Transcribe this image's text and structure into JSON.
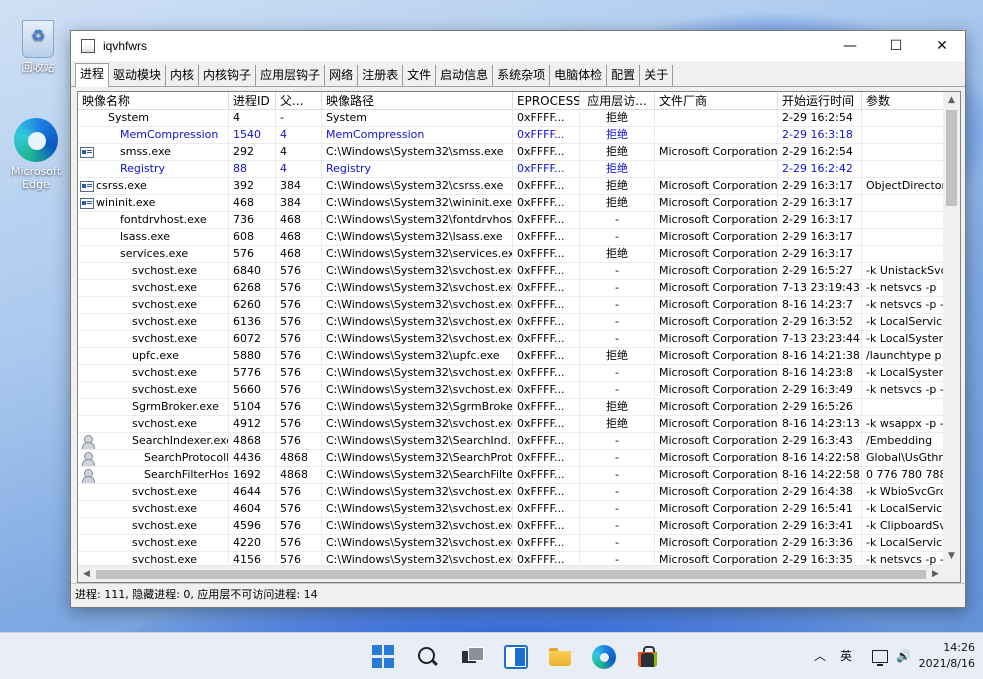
{
  "desktop": {
    "icons": [
      {
        "label": "回收站",
        "icon": "recycle-bin-icon"
      },
      {
        "label": "Microsoft Edge",
        "icon": "edge-icon"
      }
    ]
  },
  "window": {
    "title": "iqvhfwrs",
    "controls": {
      "minimize": "—",
      "maximize": "☐",
      "close": "✕"
    },
    "tabs": [
      "进程",
      "驱动模块",
      "内核",
      "内核钩子",
      "应用层钩子",
      "网络",
      "注册表",
      "文件",
      "启动信息",
      "系统杂项",
      "电脑体检",
      "配置",
      "关于"
    ],
    "active_tab": 0,
    "columns": [
      "映像名称",
      "进程ID",
      "父...",
      "映像路径",
      "EPROCESS",
      "应用层访...",
      "文件厂商",
      "开始运行时间",
      "参数"
    ],
    "rows": [
      {
        "name": "System",
        "indent": 1,
        "icon": "",
        "pid": "4",
        "ppid": "-",
        "path": "System",
        "eproc": "0xFFFF...",
        "access": "拒绝",
        "vendor": "",
        "start": "2-29 16:2:54",
        "args": "",
        "blue": false
      },
      {
        "name": "MemCompression",
        "indent": 2,
        "icon": "",
        "pid": "1540",
        "ppid": "4",
        "path": "MemCompression",
        "eproc": "0xFFFF...",
        "access": "拒绝",
        "vendor": "",
        "start": "2-29 16:3:18",
        "args": "",
        "blue": true
      },
      {
        "name": "smss.exe",
        "indent": 2,
        "icon": "app",
        "pid": "292",
        "ppid": "4",
        "path": "C:\\Windows\\System32\\smss.exe",
        "eproc": "0xFFFF...",
        "access": "拒绝",
        "vendor": "Microsoft Corporation",
        "start": "2-29 16:2:54",
        "args": "",
        "blue": false
      },
      {
        "name": "Registry",
        "indent": 2,
        "icon": "",
        "pid": "88",
        "ppid": "4",
        "path": "Registry",
        "eproc": "0xFFFF...",
        "access": "拒绝",
        "vendor": "",
        "start": "2-29 16:2:42",
        "args": "",
        "blue": true
      },
      {
        "name": "csrss.exe",
        "indent": 0,
        "icon": "app",
        "pid": "392",
        "ppid": "384",
        "path": "C:\\Windows\\System32\\csrss.exe",
        "eproc": "0xFFFF...",
        "access": "拒绝",
        "vendor": "Microsoft Corporation",
        "start": "2-29 16:3:17",
        "args": "ObjectDirector...",
        "blue": false
      },
      {
        "name": "wininit.exe",
        "indent": 0,
        "icon": "app",
        "pid": "468",
        "ppid": "384",
        "path": "C:\\Windows\\System32\\wininit.exe",
        "eproc": "0xFFFF...",
        "access": "拒绝",
        "vendor": "Microsoft Corporation",
        "start": "2-29 16:3:17",
        "args": "",
        "blue": false
      },
      {
        "name": "fontdrvhost.exe",
        "indent": 2,
        "icon": "",
        "pid": "736",
        "ppid": "468",
        "path": "C:\\Windows\\System32\\fontdrvhos...",
        "eproc": "0xFFFF...",
        "access": "-",
        "vendor": "Microsoft Corporation",
        "start": "2-29 16:3:17",
        "args": "",
        "blue": false
      },
      {
        "name": "lsass.exe",
        "indent": 2,
        "icon": "",
        "pid": "608",
        "ppid": "468",
        "path": "C:\\Windows\\System32\\lsass.exe",
        "eproc": "0xFFFF...",
        "access": "-",
        "vendor": "Microsoft Corporation",
        "start": "2-29 16:3:17",
        "args": "",
        "blue": false
      },
      {
        "name": "services.exe",
        "indent": 2,
        "icon": "",
        "pid": "576",
        "ppid": "468",
        "path": "C:\\Windows\\System32\\services.exe",
        "eproc": "0xFFFF...",
        "access": "拒绝",
        "vendor": "Microsoft Corporation",
        "start": "2-29 16:3:17",
        "args": "",
        "blue": false
      },
      {
        "name": "svchost.exe",
        "indent": 3,
        "icon": "",
        "pid": "6840",
        "ppid": "576",
        "path": "C:\\Windows\\System32\\svchost.exe",
        "eproc": "0xFFFF...",
        "access": "-",
        "vendor": "Microsoft Corporation",
        "start": "2-29 16:5:27",
        "args": "-k UnistackSvc...",
        "blue": false
      },
      {
        "name": "svchost.exe",
        "indent": 3,
        "icon": "",
        "pid": "6268",
        "ppid": "576",
        "path": "C:\\Windows\\System32\\svchost.exe",
        "eproc": "0xFFFF...",
        "access": "-",
        "vendor": "Microsoft Corporation",
        "start": "7-13 23:19:43",
        "args": "-k netsvcs -p",
        "blue": false
      },
      {
        "name": "svchost.exe",
        "indent": 3,
        "icon": "",
        "pid": "6260",
        "ppid": "576",
        "path": "C:\\Windows\\System32\\svchost.exe",
        "eproc": "0xFFFF...",
        "access": "-",
        "vendor": "Microsoft Corporation",
        "start": "8-16 14:23:7",
        "args": "-k netsvcs -p -...",
        "blue": false
      },
      {
        "name": "svchost.exe",
        "indent": 3,
        "icon": "",
        "pid": "6136",
        "ppid": "576",
        "path": "C:\\Windows\\System32\\svchost.exe",
        "eproc": "0xFFFF...",
        "access": "-",
        "vendor": "Microsoft Corporation",
        "start": "2-29 16:3:52",
        "args": "-k LocalService...",
        "blue": false
      },
      {
        "name": "svchost.exe",
        "indent": 3,
        "icon": "",
        "pid": "6072",
        "ppid": "576",
        "path": "C:\\Windows\\System32\\svchost.exe",
        "eproc": "0xFFFF...",
        "access": "-",
        "vendor": "Microsoft Corporation",
        "start": "7-13 23:23:44",
        "args": "-k LocalSystem...",
        "blue": false
      },
      {
        "name": "upfc.exe",
        "indent": 3,
        "icon": "",
        "pid": "5880",
        "ppid": "576",
        "path": "C:\\Windows\\System32\\upfc.exe",
        "eproc": "0xFFFF...",
        "access": "拒绝",
        "vendor": "Microsoft Corporation",
        "start": "8-16 14:21:38",
        "args": "/launchtype p...",
        "blue": false
      },
      {
        "name": "svchost.exe",
        "indent": 3,
        "icon": "",
        "pid": "5776",
        "ppid": "576",
        "path": "C:\\Windows\\System32\\svchost.exe",
        "eproc": "0xFFFF...",
        "access": "-",
        "vendor": "Microsoft Corporation",
        "start": "8-16 14:23:8",
        "args": "-k LocalSystem...",
        "blue": false
      },
      {
        "name": "svchost.exe",
        "indent": 3,
        "icon": "",
        "pid": "5660",
        "ppid": "576",
        "path": "C:\\Windows\\System32\\svchost.exe",
        "eproc": "0xFFFF...",
        "access": "-",
        "vendor": "Microsoft Corporation",
        "start": "2-29 16:3:49",
        "args": "-k netsvcs -p -...",
        "blue": false
      },
      {
        "name": "SgrmBroker.exe",
        "indent": 3,
        "icon": "",
        "pid": "5104",
        "ppid": "576",
        "path": "C:\\Windows\\System32\\SgrmBroke...",
        "eproc": "0xFFFF...",
        "access": "拒绝",
        "vendor": "Microsoft Corporation",
        "start": "2-29 16:5:26",
        "args": "",
        "blue": false
      },
      {
        "name": "svchost.exe",
        "indent": 3,
        "icon": "",
        "pid": "4912",
        "ppid": "576",
        "path": "C:\\Windows\\System32\\svchost.exe",
        "eproc": "0xFFFF...",
        "access": "拒绝",
        "vendor": "Microsoft Corporation",
        "start": "8-16 14:23:13",
        "args": "-k wsappx -p -...",
        "blue": false
      },
      {
        "name": "SearchIndexer.exe",
        "indent": 3,
        "icon": "user",
        "pid": "4868",
        "ppid": "576",
        "path": "C:\\Windows\\System32\\SearchInd...",
        "eproc": "0xFFFF...",
        "access": "-",
        "vendor": "Microsoft Corporation",
        "start": "2-29 16:3:43",
        "args": "/Embedding",
        "blue": false
      },
      {
        "name": "SearchProtocolH...",
        "indent": 4,
        "icon": "user",
        "pid": "4436",
        "ppid": "4868",
        "path": "C:\\Windows\\System32\\SearchProt...",
        "eproc": "0xFFFF...",
        "access": "-",
        "vendor": "Microsoft Corporation",
        "start": "8-16 14:22:58",
        "args": "Global\\UsGthr...",
        "blue": false
      },
      {
        "name": "SearchFilterHost...",
        "indent": 4,
        "icon": "user",
        "pid": "1692",
        "ppid": "4868",
        "path": "C:\\Windows\\System32\\SearchFilte...",
        "eproc": "0xFFFF...",
        "access": "-",
        "vendor": "Microsoft Corporation",
        "start": "8-16 14:22:58",
        "args": "0 776 780 788...",
        "blue": false
      },
      {
        "name": "svchost.exe",
        "indent": 3,
        "icon": "",
        "pid": "4644",
        "ppid": "576",
        "path": "C:\\Windows\\System32\\svchost.exe",
        "eproc": "0xFFFF...",
        "access": "-",
        "vendor": "Microsoft Corporation",
        "start": "2-29 16:4:38",
        "args": "-k WbioSvcGro...",
        "blue": false
      },
      {
        "name": "svchost.exe",
        "indent": 3,
        "icon": "",
        "pid": "4604",
        "ppid": "576",
        "path": "C:\\Windows\\System32\\svchost.exe",
        "eproc": "0xFFFF...",
        "access": "-",
        "vendor": "Microsoft Corporation",
        "start": "2-29 16:5:41",
        "args": "-k LocalService...",
        "blue": false
      },
      {
        "name": "svchost.exe",
        "indent": 3,
        "icon": "",
        "pid": "4596",
        "ppid": "576",
        "path": "C:\\Windows\\System32\\svchost.exe",
        "eproc": "0xFFFF...",
        "access": "-",
        "vendor": "Microsoft Corporation",
        "start": "2-29 16:3:41",
        "args": "-k ClipboardSv...",
        "blue": false
      },
      {
        "name": "svchost.exe",
        "indent": 3,
        "icon": "",
        "pid": "4220",
        "ppid": "576",
        "path": "C:\\Windows\\System32\\svchost.exe",
        "eproc": "0xFFFF...",
        "access": "-",
        "vendor": "Microsoft Corporation",
        "start": "2-29 16:3:36",
        "args": "-k LocalService...",
        "blue": false
      },
      {
        "name": "svchost.exe",
        "indent": 3,
        "icon": "",
        "pid": "4156",
        "ppid": "576",
        "path": "C:\\Windows\\System32\\svchost.exe",
        "eproc": "0xFFFF...",
        "access": "-",
        "vendor": "Microsoft Corporation",
        "start": "2-29 16:3:35",
        "args": "-k netsvcs -p -...",
        "blue": false
      }
    ],
    "status": "进程: 111, 隐藏进程: 0, 应用层不可访问进程: 14"
  },
  "taskbar": {
    "apps": [
      "start-icon",
      "search-icon",
      "task-view-icon",
      "widgets-icon",
      "file-explorer-icon",
      "edge-icon",
      "store-icon"
    ],
    "tray_chevron": "︿",
    "lang": "英",
    "volume": "🔊",
    "time": "14:26",
    "date": "2021/8/16"
  },
  "colors": {
    "accent_blue": "#1010d8",
    "taskbar": "#e9eef6"
  }
}
